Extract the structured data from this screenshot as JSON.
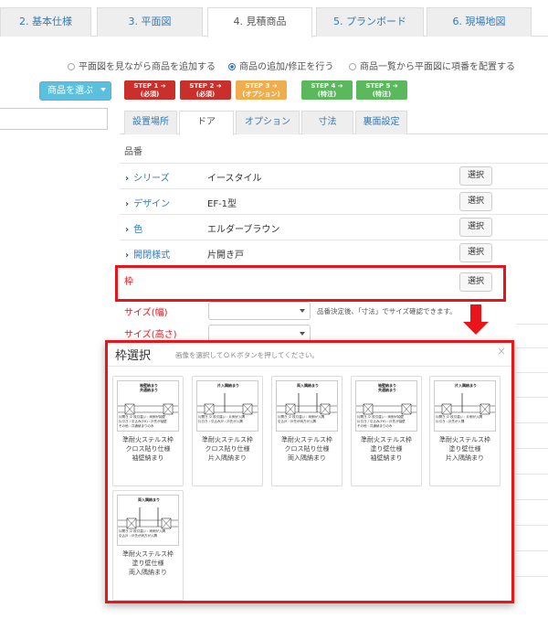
{
  "top_tabs": [
    "2. 基本仕様",
    "3. 平面図",
    "4. 見積商品",
    "5. プランボード",
    "6. 現場地図"
  ],
  "radios": [
    {
      "label": "平面図を見ながら商品を追加する",
      "checked": false
    },
    {
      "label": "商品の追加/修正を行う",
      "checked": true
    },
    {
      "label": "商品一覧から平面図に項番を配置する",
      "checked": false
    }
  ],
  "choose_button": "商品を選ぶ",
  "steps": [
    {
      "line1": "STEP 1 ➔",
      "line2": "(必須)",
      "color": "#c9302c"
    },
    {
      "line1": "STEP 2 ➔",
      "line2": "(必須)",
      "color": "#c9302c"
    },
    {
      "line1": "STEP 3 ➔",
      "line2": "(オプション)",
      "color": "#f0ad4e"
    },
    {
      "line1": "STEP 4 ➔",
      "line2": "(特注)",
      "color": "#5cb85c"
    },
    {
      "line1": "STEP 5 ➔",
      "line2": "(特注)",
      "color": "#5cb85c"
    }
  ],
  "sub_tabs": [
    "設置場所",
    "ドア",
    "オプション",
    "寸法",
    "裏面設定"
  ],
  "hinban_label": "品番",
  "rows": [
    {
      "label": "シリーズ",
      "value": "イースタイル",
      "button": "選択"
    },
    {
      "label": "デザイン",
      "value": "EF-1型",
      "button": "選択"
    },
    {
      "label": "色",
      "value": "エルダーブラウン",
      "button": "選択"
    },
    {
      "label": "開閉様式",
      "value": "片開き戸",
      "button": "選択"
    }
  ],
  "waku": {
    "label": "枠",
    "button": "選択"
  },
  "size_width_label": "サイズ(幅)",
  "size_height_label": "サイズ(高さ)",
  "size_note": "品番決定後、「寸法」でサイズ確認できます。",
  "modal": {
    "title": "枠選択",
    "subtitle": "画像を選択してＯＫボタンを押してください。",
    "close": "×",
    "cards": [
      {
        "img_title1": "袖壁納まり",
        "img_title2": "共通納まり",
        "notes": [
          "片開き /2 枚引違い : 両側が袖壁",
          "片引き / 引込み(FH) : 戸先が袖壁",
          "その他 : 共通納まりのみ"
        ],
        "caption1": "準耐火ステルス枠",
        "caption2": "クロス貼り仕様",
        "caption3": "袖壁納まり"
      },
      {
        "img_title1": "片入隅納まり",
        "img_title2": "",
        "notes": [
          "片開き /2 枚引違い : 片側が入隅",
          "片引き / 引込み戸 : 戸先が入隅",
          ""
        ],
        "caption1": "準耐火ステルス枠",
        "caption2": "クロス貼り仕様",
        "caption3": "片入隅納まり"
      },
      {
        "img_title1": "両入隅納まり",
        "img_title2": "",
        "notes": [
          "片開き /2 枚引違い : 両側が入隅",
          "引込戸 : 戸先が両方が入隅",
          ""
        ],
        "caption1": "準耐火ステルス枠",
        "caption2": "クロス貼り仕様",
        "caption3": "両入隅納まり"
      },
      {
        "img_title1": "袖壁納まり",
        "img_title2": "共通納まり",
        "notes": [
          "片開き /2 枚引違い : 両側が袖壁",
          "片引き / 引込み(FH) : 戸先が袖壁",
          "その他 : 共通納まりのみ"
        ],
        "caption1": "準耐火ステルス枠",
        "caption2": "塗り壁仕様",
        "caption3": "袖壁納まり"
      },
      {
        "img_title1": "片入隅納まり",
        "img_title2": "",
        "notes": [
          "片開き /2 枚引違い : 片側が入隅",
          "片引き : 戸先が入隅",
          ""
        ],
        "caption1": "準耐火ステルス枠",
        "caption2": "塗り壁仕様",
        "caption3": "片入隅納まり"
      },
      {
        "img_title1": "両入隅納まり",
        "img_title2": "",
        "notes": [
          "片開き /2 枚引違い : 両側が入隅",
          "引込戸 : 戸先が両方が入隅",
          ""
        ],
        "caption1": "準耐火ステルス枠",
        "caption2": "塗り壁仕様",
        "caption3": "両入隅納まり"
      }
    ]
  },
  "colors": {
    "accent_red": "#e8161b",
    "link_blue": "#337ab7",
    "info_blue": "#5bc0de"
  }
}
